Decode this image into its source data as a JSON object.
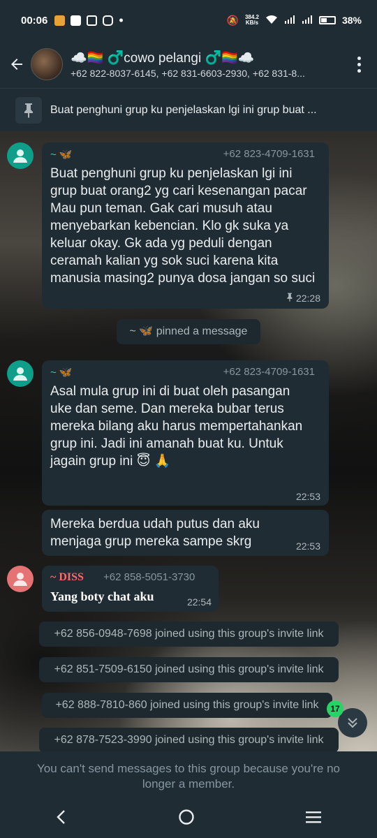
{
  "status_bar": {
    "time": "00:06",
    "net_speed": "384.2\nKB/s",
    "battery": "38%"
  },
  "header": {
    "group_name": "☁️🏳️‍🌈 ♂️cowo pelangi ♂️🏳️‍🌈☁️",
    "members": "+62 822-8037-6145, +62 831-6603-2930, +62 831-8..."
  },
  "pinned": {
    "text": "Buat penghuni grup ku penjelaskan lgi ini grup buat ..."
  },
  "messages": [
    {
      "sender": "~ 🦋",
      "phone": "+62 823-4709-1631",
      "text": "Buat penghuni grup ku penjelaskan lgi ini grup buat orang2 yg cari kesenangan pacar Mau pun teman. Gak cari musuh atau menyebarkan kebencian. Klo gk suka ya keluar okay. Gk ada yg peduli dengan ceramah kalian yg sok suci karena kita manusia masing2 punya dosa jangan so suci",
      "time": "22:28"
    },
    {
      "sender": "~ 🦋",
      "phone": "+62 823-4709-1631",
      "text": "Asal mula grup ini di buat oleh pasangan uke dan seme. Dan mereka bubar terus mereka bilang aku harus mempertahankan grup ini. Jadi ini amanah buat ku. Untuk jagain grup ini 😇 🙏",
      "time": "22:53"
    },
    {
      "text": "Mereka berdua udah putus dan aku menjaga grup mereka sampe skrg",
      "time": "22:53"
    },
    {
      "sender": "~ DISS",
      "phone": "+62 858-5051-3730",
      "text": "Yang boty chat aku",
      "time": "22:54"
    }
  ],
  "system": {
    "pinned_notice": "~ 🦋 pinned a message",
    "joined": [
      "+62 856-0948-7698 joined using this group's invite link",
      "+62 851-7509-6150 joined using this group's invite link",
      "+62 888-7810-860 joined using this group's invite link",
      "+62 878-7523-3990 joined using this group's invite link"
    ]
  },
  "unread_count": "17",
  "footer": {
    "notice": "You can't send messages to this group because you're no longer a member."
  },
  "colors": {
    "bar": "#1f2c34",
    "bubble": "#202c33",
    "accent": "#25d366",
    "sender1": "#4fc3a1",
    "sender2": "#ff6b6b"
  }
}
